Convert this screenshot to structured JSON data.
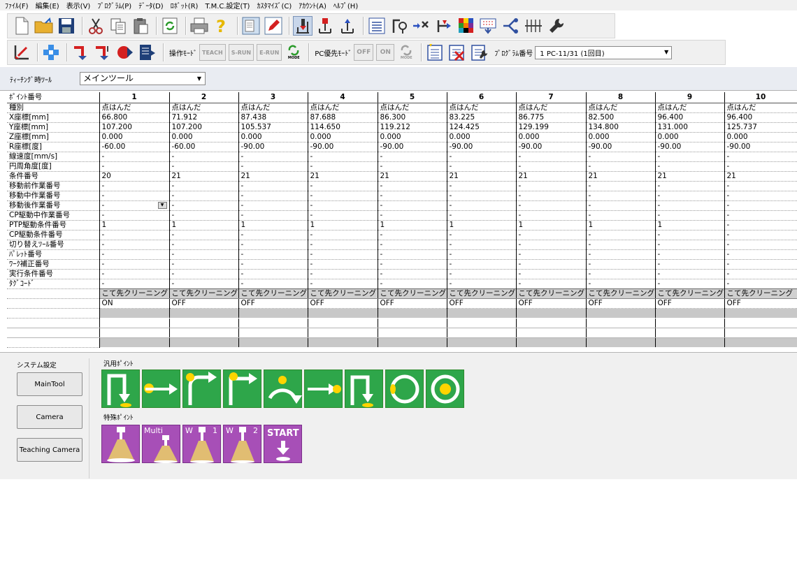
{
  "menu": [
    "ﾌｧｲﾙ(F)",
    "編集(E)",
    "表示(V)",
    "ﾌﾟﾛｸﾞﾗﾑ(P)",
    "ﾃﾞｰﾀ(D)",
    "ﾛﾎﾞｯﾄ(R)",
    "T.M.C.設定(T)",
    "ｶｽﾀﾏｲｽﾞ(C)",
    "ｱｶｳﾝﾄ(A)",
    "ﾍﾙﾌﾟ(H)"
  ],
  "toolbar2": {
    "mode_label": "操作ﾓｰﾄﾞ",
    "mode_buttons": [
      "TEACH",
      "S-RUN",
      "E-RUN"
    ],
    "mode_icon_label": "MODE",
    "pc_label": "PC優先ﾓｰﾄﾞ",
    "pc_buttons": [
      "OFF",
      "ON"
    ],
    "pc_icon_label": "MODE",
    "program_label": "ﾌﾟﾛｸﾞﾗﾑ番号",
    "program_value": "1   PC-11/31 (1回目)"
  },
  "teaching_tool": {
    "label": "ﾃｨｰﾁﾝｸﾞ時ﾂｰﾙ",
    "value": "メインツール"
  },
  "grid": {
    "corner_label": "ﾎﾟｲﾝﾄ番号",
    "columns": [
      "1",
      "2",
      "3",
      "4",
      "5",
      "6",
      "7",
      "8",
      "9",
      "10"
    ],
    "rows": [
      {
        "label": "種別",
        "values": [
          "点はんだ",
          "点はんだ",
          "点はんだ",
          "点はんだ",
          "点はんだ",
          "点はんだ",
          "点はんだ",
          "点はんだ",
          "点はんだ",
          "点はんだ"
        ]
      },
      {
        "label": "X座標[mm]",
        "values": [
          "66.800",
          "71.912",
          "87.438",
          "87.688",
          "86.300",
          "83.225",
          "86.775",
          "82.500",
          "96.400",
          "96.400"
        ]
      },
      {
        "label": "Y座標[mm]",
        "values": [
          "107.200",
          "107.200",
          "105.537",
          "114.650",
          "119.212",
          "124.425",
          "129.199",
          "134.800",
          "131.000",
          "125.737"
        ]
      },
      {
        "label": "Z座標[mm]",
        "values": [
          "0.000",
          "0.000",
          "0.000",
          "0.000",
          "0.000",
          "0.000",
          "0.000",
          "0.000",
          "0.000",
          "0.000"
        ]
      },
      {
        "label": "R座標[度]",
        "values": [
          "-60.00",
          "-60.00",
          "-90.00",
          "-90.00",
          "-90.00",
          "-90.00",
          "-90.00",
          "-90.00",
          "-90.00",
          "-90.00"
        ]
      },
      {
        "label": "線速度[mm/s]",
        "values": [
          "-",
          "-",
          "-",
          "-",
          "-",
          "-",
          "-",
          "-",
          "-",
          "-"
        ]
      },
      {
        "label": "円周角度[度]",
        "values": [
          "-",
          "-",
          "-",
          "-",
          "-",
          "-",
          "-",
          "-",
          "-",
          "-"
        ]
      },
      {
        "label": "条件番号",
        "values": [
          "20",
          "21",
          "21",
          "21",
          "21",
          "21",
          "21",
          "21",
          "21",
          "21"
        ]
      },
      {
        "label": "移動前作業番号",
        "values": [
          "-",
          "-",
          "-",
          "-",
          "-",
          "-",
          "-",
          "-",
          "-",
          "-"
        ]
      },
      {
        "label": "移動中作業番号",
        "values": [
          "-",
          "-",
          "-",
          "-",
          "-",
          "-",
          "-",
          "-",
          "-",
          "-"
        ]
      },
      {
        "label": "移動後作業番号",
        "values": [
          "-",
          "-",
          "-",
          "-",
          "-",
          "-",
          "-",
          "-",
          "-",
          "-"
        ]
      },
      {
        "label": "CP駆動中作業番号",
        "values": [
          "-",
          "-",
          "-",
          "-",
          "-",
          "-",
          "-",
          "-",
          "-",
          "-"
        ]
      },
      {
        "label": "PTP駆動条件番号",
        "values": [
          "1",
          "1",
          "1",
          "1",
          "1",
          "1",
          "1",
          "1",
          "1",
          "-"
        ]
      },
      {
        "label": "CP駆動条件番号",
        "values": [
          "-",
          "-",
          "-",
          "-",
          "-",
          "-",
          "-",
          "-",
          "-",
          "-"
        ]
      },
      {
        "label": "切り替えﾂｰﾙ番号",
        "values": [
          "-",
          "-",
          "-",
          "-",
          "-",
          "-",
          "-",
          "-",
          "-",
          "-"
        ]
      },
      {
        "label": "ﾊﾟﾚｯﾄ番号",
        "values": [
          "-",
          "-",
          "-",
          "-",
          "-",
          "-",
          "-",
          "-",
          "-",
          "-"
        ]
      },
      {
        "label": "ﾜｰｸ補正番号",
        "values": [
          "-",
          "-",
          "-",
          "-",
          "-",
          "-",
          "-",
          "-",
          "-",
          "-"
        ]
      },
      {
        "label": "実行条件番号",
        "values": [
          "-",
          "-",
          "-",
          "-",
          "-",
          "-",
          "-",
          "-",
          "-",
          "-"
        ]
      },
      {
        "label": "ﾀｸﾞｺｰﾄﾞ",
        "values": [
          "-",
          "-",
          "-",
          "-",
          "-",
          "-",
          "-",
          "-",
          "-",
          "-"
        ]
      }
    ],
    "cleaning_label": "こて先クリーニング",
    "cleaning_states": [
      "ON",
      "OFF",
      "OFF",
      "OFF",
      "OFF",
      "OFF",
      "OFF",
      "OFF",
      "OFF",
      "OFF"
    ]
  },
  "system": {
    "group_label": "システム設定",
    "buttons": [
      "MainTool",
      "Camera",
      "Teaching Camera"
    ]
  },
  "general_points": {
    "label": "汎用ﾎﾟｲﾝﾄ"
  },
  "special_points": {
    "label": "特殊ﾎﾟｲﾝﾄ",
    "tiles": [
      {
        "text": ""
      },
      {
        "text": "Multi"
      },
      {
        "text": "W",
        "num": "1"
      },
      {
        "text": "W",
        "num": "2"
      },
      {
        "text": "START"
      }
    ]
  }
}
